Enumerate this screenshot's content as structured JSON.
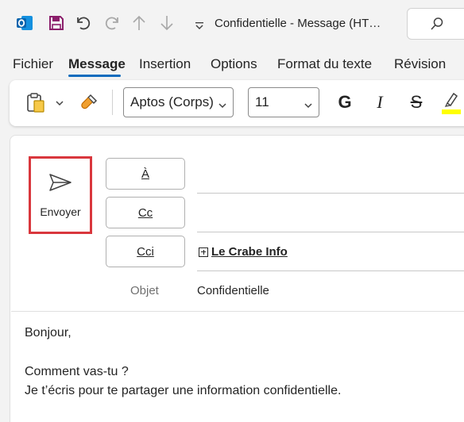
{
  "titlebar": {
    "icons": [
      "outlook-app-icon",
      "save-icon",
      "undo-icon",
      "redo-icon",
      "up-arrow-icon",
      "down-arrow-icon",
      "customize-dropdown-icon"
    ],
    "title": "Confidentielle  -  Message (HT…",
    "search_icon": "search-icon"
  },
  "tabs": [
    {
      "label": "Fichier",
      "active": false
    },
    {
      "label": "Message",
      "active": true
    },
    {
      "label": "Insertion",
      "active": false
    },
    {
      "label": "Options",
      "active": false
    },
    {
      "label": "Format du texte",
      "active": false
    },
    {
      "label": "Révision",
      "active": false
    }
  ],
  "ribbon": {
    "font_name": "Aptos (Corps)",
    "font_size": "11",
    "bold_label": "G",
    "italic_label": "I",
    "strike_label": "S",
    "highlight_color": "#ffff00"
  },
  "compose": {
    "send_label": "Envoyer",
    "to_label": "À",
    "cc_label": "Cc",
    "bcc_label": "Cci",
    "bcc_recipient": "Le Crabe Info",
    "subject_label": "Objet",
    "subject_value": "Confidentielle",
    "body_lines": [
      "Bonjour,",
      "",
      "Comment vas-tu ?",
      "Je t’écris pour te partager une information confidentielle."
    ]
  },
  "colors": {
    "accent": "#0f6cbd",
    "send_highlight": "#d9373d",
    "save_icon": "#8b1e6b"
  }
}
